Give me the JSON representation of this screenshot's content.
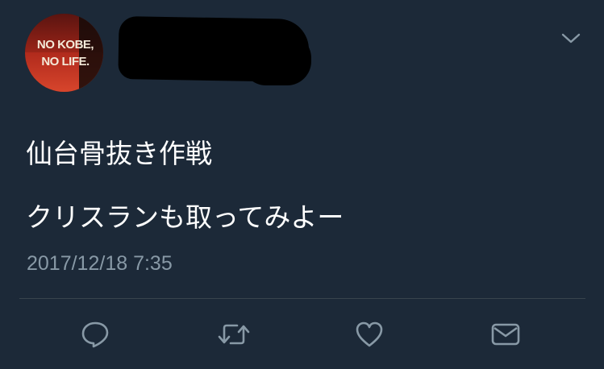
{
  "avatar": {
    "line1": "NO KOBE,",
    "line2": "NO LIFE."
  },
  "tweet": {
    "text_line1": "仙台骨抜き作戦",
    "text_line2": "クリスランも取ってみよー",
    "timestamp": "2017/12/18 7:35"
  },
  "actions": {
    "reply_icon": "reply-icon",
    "retweet_icon": "retweet-icon",
    "like_icon": "heart-icon",
    "dm_icon": "envelope-icon"
  },
  "colors": {
    "background": "#1c2938",
    "text": "#ffffff",
    "secondary": "#8899a6"
  }
}
